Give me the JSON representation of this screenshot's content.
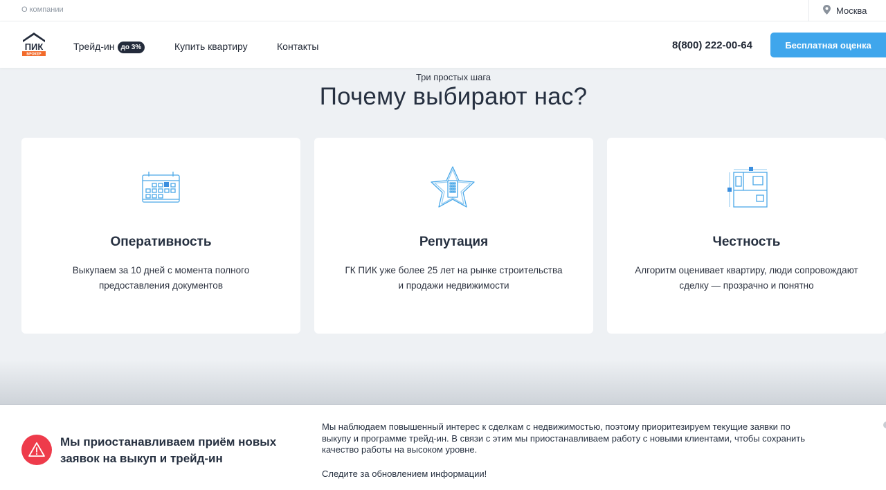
{
  "topbar": {
    "about_label": "О компании",
    "city_label": "Москва"
  },
  "header": {
    "logo_text_main": "ПИК",
    "logo_text_sub": "БРОКЕР",
    "nav": [
      {
        "label": "Трейд-ин",
        "badge": "до 3%"
      },
      {
        "label": "Купить квартиру"
      },
      {
        "label": "Контакты"
      }
    ],
    "phone": "8(800) 222-00-64",
    "cta_label": "Бесплатная оценка"
  },
  "main": {
    "subtitle": "Три простых шага",
    "title": "Почему выбирают нас?",
    "cards": [
      {
        "icon": "calendar-icon",
        "title": "Оперативность",
        "desc": "Выкупаем за 10 дней с момента полного предоставления документов"
      },
      {
        "icon": "star-building-icon",
        "title": "Репутация",
        "desc": "ГК ПИК уже более 25 лет на рынке строительства и продажи недвижимости"
      },
      {
        "icon": "floor-plan-icon",
        "title": "Честность",
        "desc": "Алгоритм оценивает квартиру, люди сопровождают сделку — прозрачно и понятно"
      }
    ]
  },
  "notice": {
    "title": "Мы приостанавливаем приём новых заявок на выкуп и трейд-ин",
    "text": "Мы наблюдаем повышенный интерес к сделкам с недвижимостью, поэтому приоритезируем текущие заявки по выкупу и программе трейд-ин. В связи с этим мы приостанавливаем работу с новыми клиентами, чтобы сохранить качество работы на высоком уровне.",
    "follow": "Следите за обновлением информации!"
  },
  "colors": {
    "accent": "#3fa6ec",
    "brand_dark": "#232b3b",
    "brand_orange": "#f26b2b",
    "warning": "#ee3b4b",
    "icon_blue": "#4aa8e8"
  }
}
